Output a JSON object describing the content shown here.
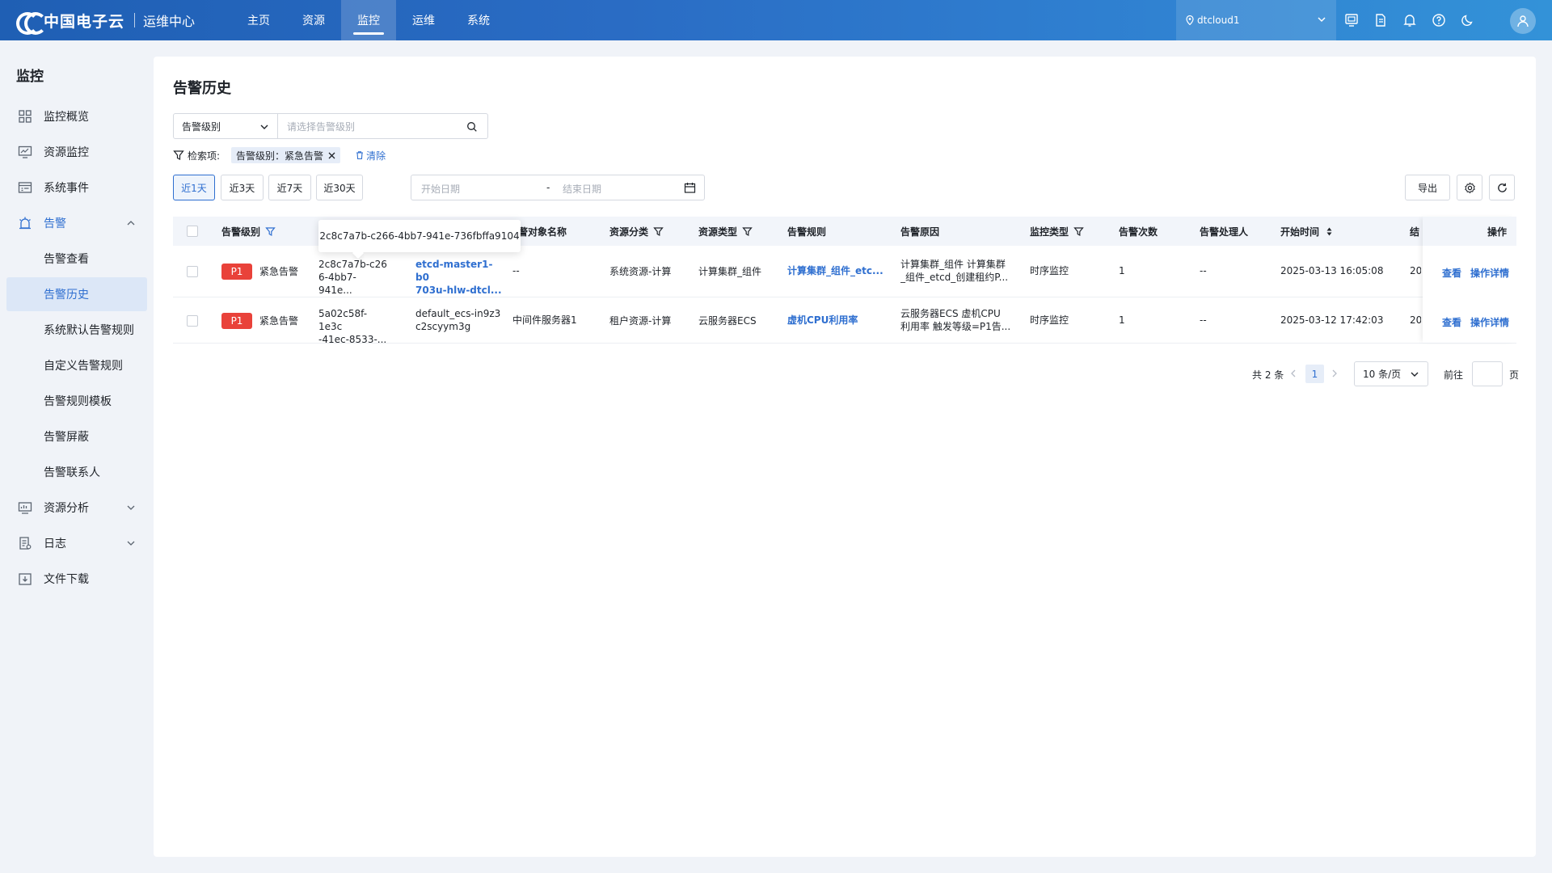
{
  "app": {
    "brand": "中国电子云",
    "subtitle": "运维中心"
  },
  "topnav": {
    "items": [
      {
        "label": "主页"
      },
      {
        "label": "资源"
      },
      {
        "label": "监控"
      },
      {
        "label": "运维"
      },
      {
        "label": "系统"
      }
    ],
    "active": "监控"
  },
  "tenant": {
    "name": "dtcloud1"
  },
  "sidebar": {
    "title": "监控",
    "items": [
      {
        "label": "监控概览",
        "icon": "grid-icon"
      },
      {
        "label": "资源监控",
        "icon": "monitor-chart-icon"
      },
      {
        "label": "系统事件",
        "icon": "event-log-icon"
      },
      {
        "label": "告警",
        "icon": "alarm-icon"
      },
      {
        "label": "告警查看"
      },
      {
        "label": "告警历史"
      },
      {
        "label": "系统默认告警规则"
      },
      {
        "label": "自定义告警规则"
      },
      {
        "label": "告警规则模板"
      },
      {
        "label": "告警屏蔽"
      },
      {
        "label": "告警联系人"
      },
      {
        "label": "资源分析",
        "icon": "analysis-icon"
      },
      {
        "label": "日志",
        "icon": "log-icon"
      },
      {
        "label": "文件下载",
        "icon": "download-icon"
      }
    ]
  },
  "page": {
    "title": "告警历史",
    "filter": {
      "field": "告警级别",
      "placeholder": "请选择告警级别"
    },
    "criteria": {
      "label": "检索项:",
      "chip": "告警级别：紧急告警",
      "clear": "清除"
    },
    "ranges": [
      "近1天",
      "近3天",
      "近7天",
      "近30天"
    ],
    "active_range": "近1天",
    "date_start_placeholder": "开始日期",
    "date_separator": "-",
    "date_end_placeholder": "结束日期",
    "export_label": "导出"
  },
  "table": {
    "headers": {
      "level": "告警级别",
      "object_name": "告警对象名称",
      "res_category": "资源分类",
      "res_type": "资源类型",
      "rule": "告警规则",
      "reason": "告警原因",
      "monitor_type": "监控类型",
      "count": "告警次数",
      "handler": "告警处理人",
      "start_time": "开始时间",
      "end_time_partial": "结",
      "ops": "操作"
    },
    "rows": [
      {
        "level_badge": "P1",
        "level_text": "紧急告警",
        "id_line1": "2c8c7a7b-c26",
        "id_line2": "6-4bb7-941e...",
        "obj_line1": "etcd-master1-b0",
        "obj_line2": "703u-hlw-dtcl...",
        "object_name": "--",
        "res_category": "系统资源-计算",
        "res_type": "计算集群_组件",
        "rule": "计算集群_组件_etc...",
        "reason_line1": "计算集群_组件 计算集群",
        "reason_line2": "_组件_etcd_创建租约P...",
        "monitor_type": "时序监控",
        "count": "1",
        "handler": "--",
        "start_time": "2025-03-13 16:05:08",
        "end_time_partial": "20",
        "op_view": "查看",
        "op_detail": "操作详情"
      },
      {
        "level_badge": "P1",
        "level_text": "紧急告警",
        "id_line1": "5a02c58f-1e3c",
        "id_line2": "-41ec-8533-...",
        "obj_line1": "default_ecs-in9z3",
        "obj_line2": "c2scyym3g",
        "object_name": "中间件服务器1",
        "res_category": "租户资源-计算",
        "res_type": "云服务器ECS",
        "rule": "虚机CPU利用率",
        "reason_line1": "云服务器ECS 虚机CPU",
        "reason_line2": "利用率 触发等级=P1告...",
        "monitor_type": "时序监控",
        "count": "1",
        "handler": "--",
        "start_time": "2025-03-12 17:42:03",
        "end_time_partial": "20",
        "op_view": "查看",
        "op_detail": "操作详情"
      }
    ],
    "tooltip": "2c8c7a7b-c266-4bb7-941e-736fbffa9104"
  },
  "pagination": {
    "total": "共 2 条",
    "current": "1",
    "page_size": "10 条/页",
    "goto_label": "前往",
    "page_suffix": "页"
  },
  "colors": {
    "brand_blue": "#2f6fd0",
    "badge_red": "#e9423a"
  }
}
